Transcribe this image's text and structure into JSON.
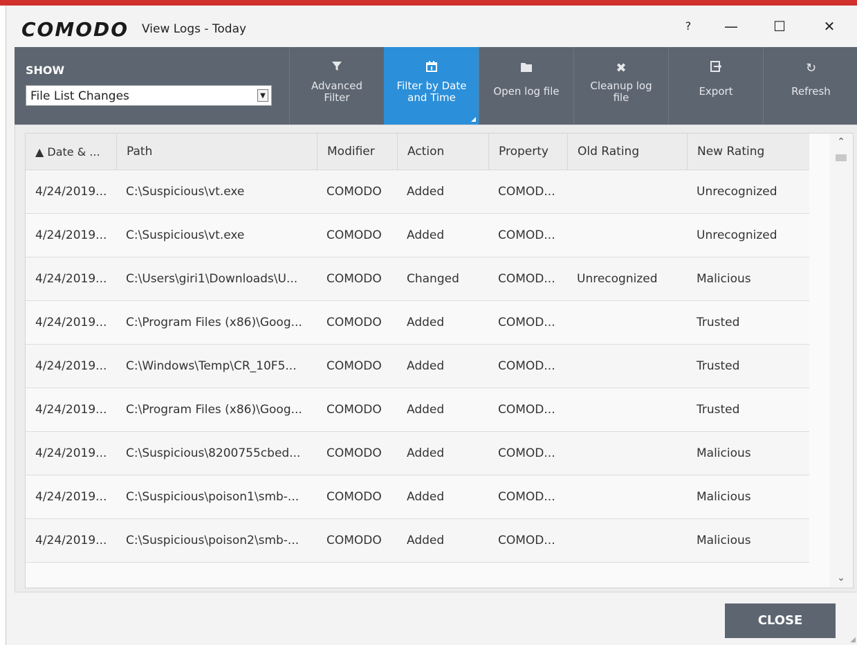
{
  "window": {
    "logo": "COMODO",
    "title": "View Logs - Today",
    "help": "?",
    "minimize": "—",
    "maximize": "☐",
    "close": "✕"
  },
  "toolbar": {
    "show_label": "SHOW",
    "show_value": "File List Changes",
    "buttons": [
      {
        "icon": "funnel-icon",
        "label": "Advanced Filter"
      },
      {
        "icon": "calendar-icon",
        "label": "Filter by Date and Time",
        "active": true
      },
      {
        "icon": "folder-icon",
        "label": "Open log file"
      },
      {
        "icon": "x-icon",
        "label": "Cleanup log file"
      },
      {
        "icon": "export-icon",
        "label": "Export"
      },
      {
        "icon": "refresh-icon",
        "label": "Refresh"
      }
    ]
  },
  "table": {
    "columns": [
      "▲ Date & ...",
      "Path",
      "Modifier",
      "Action",
      "Property",
      "Old Rating",
      "New Rating"
    ],
    "rows": [
      [
        "4/24/2019...",
        "C:\\Suspicious\\vt.exe",
        "COMODO",
        "Added",
        "COMOD...",
        "",
        "Unrecognized"
      ],
      [
        "4/24/2019...",
        "C:\\Suspicious\\vt.exe",
        "COMODO",
        "Added",
        "COMOD...",
        "",
        "Unrecognized"
      ],
      [
        "4/24/2019...",
        "C:\\Users\\giri1\\Downloads\\U...",
        "COMODO",
        "Changed",
        "COMOD...",
        "Unrecognized",
        "Malicious"
      ],
      [
        "4/24/2019...",
        "C:\\Program Files (x86)\\Goog...",
        "COMODO",
        "Added",
        "COMOD...",
        "",
        "Trusted"
      ],
      [
        "4/24/2019...",
        "C:\\Windows\\Temp\\CR_10F5...",
        "COMODO",
        "Added",
        "COMOD...",
        "",
        "Trusted"
      ],
      [
        "4/24/2019...",
        "C:\\Program Files (x86)\\Goog...",
        "COMODO",
        "Added",
        "COMOD...",
        "",
        "Trusted"
      ],
      [
        "4/24/2019...",
        "C:\\Suspicious\\8200755cbed...",
        "COMODO",
        "Added",
        "COMOD...",
        "",
        "Malicious"
      ],
      [
        "4/24/2019...",
        "C:\\Suspicious\\poison1\\smb-...",
        "COMODO",
        "Added",
        "COMOD...",
        "",
        "Malicious"
      ],
      [
        "4/24/2019...",
        "C:\\Suspicious\\poison2\\smb-...",
        "COMODO",
        "Added",
        "COMOD...",
        "",
        "Malicious"
      ]
    ]
  },
  "footer": {
    "close_label": "CLOSE"
  },
  "colors": {
    "toolbar_bg": "#5d6571",
    "active_button": "#2b8fd9",
    "top_accent": "#d0312d"
  }
}
